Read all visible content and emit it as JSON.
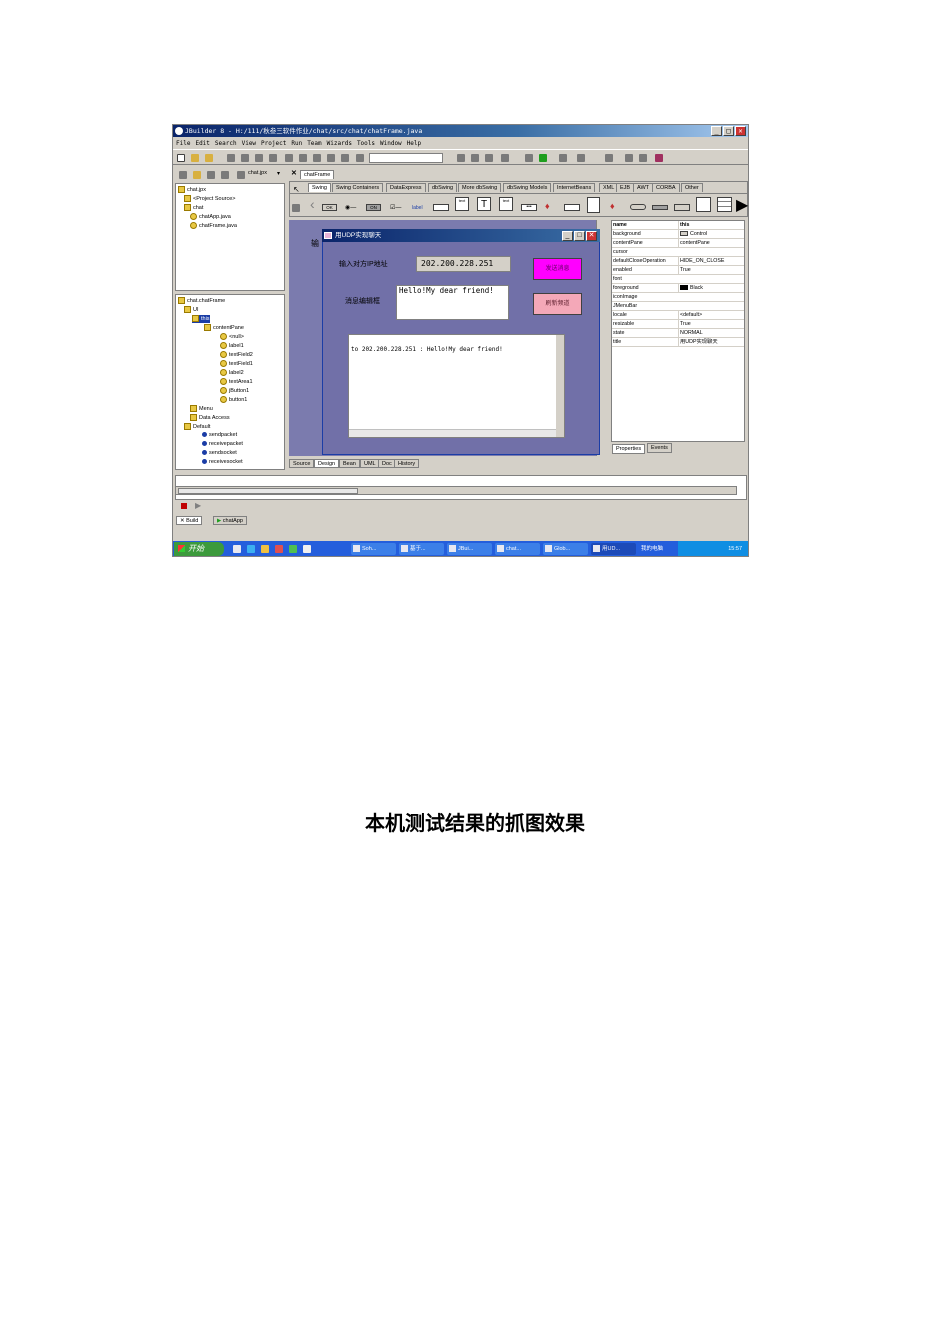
{
  "window": {
    "title": "JBuilder 8 - H:/111/秋叁三软件作业/chat/src/chat/chatFrame.java",
    "minimize": "_",
    "maximize": "□",
    "close": "✕"
  },
  "menu": [
    "File",
    "Edit",
    "Search",
    "View",
    "Project",
    "Run",
    "Team",
    "Wizards",
    "Tools",
    "Window",
    "Help"
  ],
  "project": {
    "combo_label": "chat.jpx",
    "tree": [
      "chat.jpx",
      "<Project Source>",
      "chat",
      "chatApp.java",
      "chatFrame.java"
    ]
  },
  "structure": {
    "root": "chat.chatFrame",
    "items": [
      "UI",
      "this",
      "contentPane",
      "<null>",
      "label1",
      "textField2",
      "textField1",
      "label2",
      "textArea1",
      "jButton1",
      "button1",
      "Menu",
      "Data Access",
      "Default",
      "sendpacket",
      "receivepacket",
      "sendsocket",
      "receivesocket"
    ]
  },
  "file_tab": "chatFrame",
  "palette_tabs": [
    "Swing",
    "Swing Containers",
    "DataExpress",
    "dbSwing",
    "More dbSwing",
    "dbSwing Models",
    "InternetBeans",
    "XML",
    "EJB",
    "AWT",
    "CORBA",
    "Other"
  ],
  "palette_items": {
    "ok": "OK",
    "on": "ON",
    "label": "label",
    "text": "text",
    "big_t": "T"
  },
  "designer_partial_text": "输",
  "app_window": {
    "title": "用UDP实现聊天",
    "ip_label": "输入对方IP地址",
    "ip_value": "202.200.228.251",
    "send_button": "发送消息",
    "msg_label": "消息编辑框",
    "msg_value": "Hello!My dear friend!",
    "refresh_button": "刷新频道",
    "log_text": "to 202.200.228.251 : Hello!My dear friend!"
  },
  "properties": [
    {
      "k": "name",
      "v": "this"
    },
    {
      "k": "background",
      "v": "Control"
    },
    {
      "k": "contentPane",
      "v": "contentPane"
    },
    {
      "k": "cursor",
      "v": ""
    },
    {
      "k": "defaultCloseOperation",
      "v": "HIDE_ON_CLOSE"
    },
    {
      "k": "enabled",
      "v": "True"
    },
    {
      "k": "font",
      "v": ""
    },
    {
      "k": "foreground",
      "v": "Black"
    },
    {
      "k": "iconImage",
      "v": ""
    },
    {
      "k": "JMenuBar",
      "v": ""
    },
    {
      "k": "locale",
      "v": "<default>"
    },
    {
      "k": "resizable",
      "v": "True"
    },
    {
      "k": "state",
      "v": "NORMAL"
    },
    {
      "k": "title",
      "v": "用UDP实现聊天"
    }
  ],
  "prop_tabs": [
    "Properties",
    "Events"
  ],
  "editor_tabs": [
    "Source",
    "Design",
    "Bean",
    "UML",
    "Doc",
    "History"
  ],
  "bottom_tabs": [
    "Build",
    "chatApp"
  ],
  "taskbar": {
    "start": "开始",
    "tasks": [
      "Soh...",
      "基于...",
      "JBui...",
      "chat...",
      "Glob...",
      "用UD..."
    ],
    "tray_text": "我的电脑",
    "time": "15:57"
  },
  "caption": "本机测试结果的抓图效果"
}
